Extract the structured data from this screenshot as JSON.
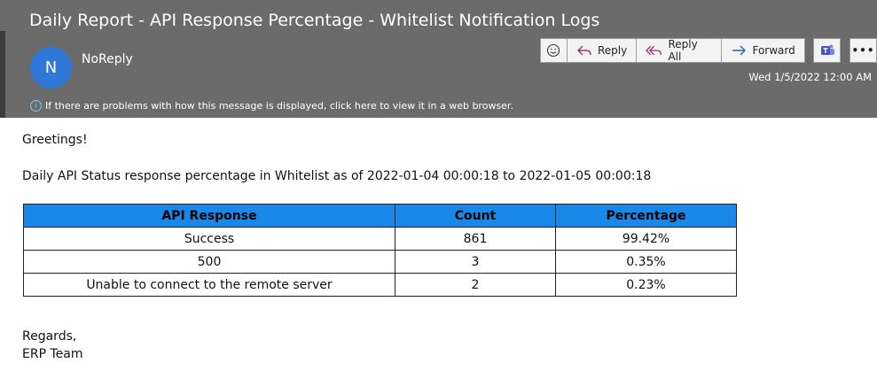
{
  "header": {
    "subject": "Daily Report - API Response Percentage - Whitelist Notification Logs",
    "avatar_letter": "N",
    "sender": "NoReply",
    "date": "Wed 1/5/2022 12:00 AM",
    "info_text": "If there are problems with how this message is displayed, click here to view it in a web browser."
  },
  "toolbar": {
    "reply": "Reply",
    "reply_all": "Reply All",
    "forward": "Forward",
    "more": "•••"
  },
  "message": {
    "greeting": "Greetings!",
    "intro": "Daily API Status response percentage in Whitelist as of  2022-01-04 00:00:18  to  2022-01-05 00:00:18",
    "table": {
      "headers": [
        "API Response",
        "Count",
        "Percentage"
      ],
      "rows": [
        [
          "Success",
          "861",
          "99.42%"
        ],
        [
          "500",
          "3",
          "0.35%"
        ],
        [
          "Unable to connect to the remote server",
          "2",
          "0.23%"
        ]
      ]
    },
    "regards": "Regards,",
    "team": "ERP Team"
  },
  "colors": {
    "header_bg": "#6b6b6b",
    "table_header_bg": "#1a88e8",
    "avatar_bg": "#2f78d8"
  }
}
